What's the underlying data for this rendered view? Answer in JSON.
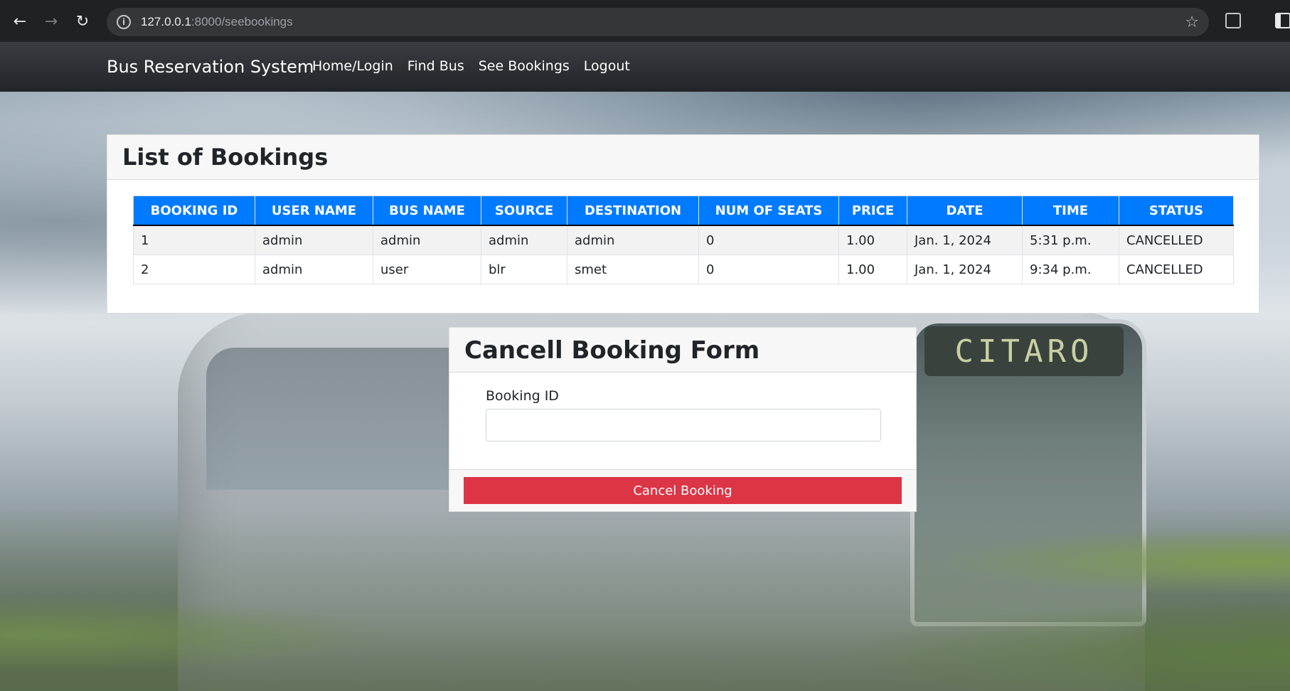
{
  "browser": {
    "url_host": "127.0.0.1",
    "url_path": ":8000/seebookings"
  },
  "navbar": {
    "brand": "Bus Reservation System",
    "links": [
      "Home/Login",
      "Find Bus",
      "See Bookings",
      "Logout"
    ]
  },
  "bookings": {
    "title": "List of Bookings",
    "columns": [
      "BOOKING ID",
      "USER NAME",
      "BUS NAME",
      "SOURCE",
      "DESTINATION",
      "NUM OF SEATS",
      "PRICE",
      "DATE",
      "TIME",
      "STATUS"
    ],
    "rows": [
      [
        "1",
        "admin",
        "admin",
        "admin",
        "admin",
        "0",
        "1.00",
        "Jan. 1, 2024",
        "5:31 p.m.",
        "CANCELLED"
      ],
      [
        "2",
        "admin",
        "user",
        "blr",
        "smet",
        "0",
        "1.00",
        "Jan. 1, 2024",
        "9:34 p.m.",
        "CANCELLED"
      ]
    ]
  },
  "cancel_form": {
    "title": "Cancell Booking Form",
    "booking_id_label": "Booking ID",
    "booking_id_value": "",
    "submit_label": "Cancel Booking"
  },
  "background": {
    "bus_sign": "CITARO"
  },
  "colors": {
    "primary": "#007bff",
    "danger": "#dc3545",
    "navbar": "#212529"
  }
}
